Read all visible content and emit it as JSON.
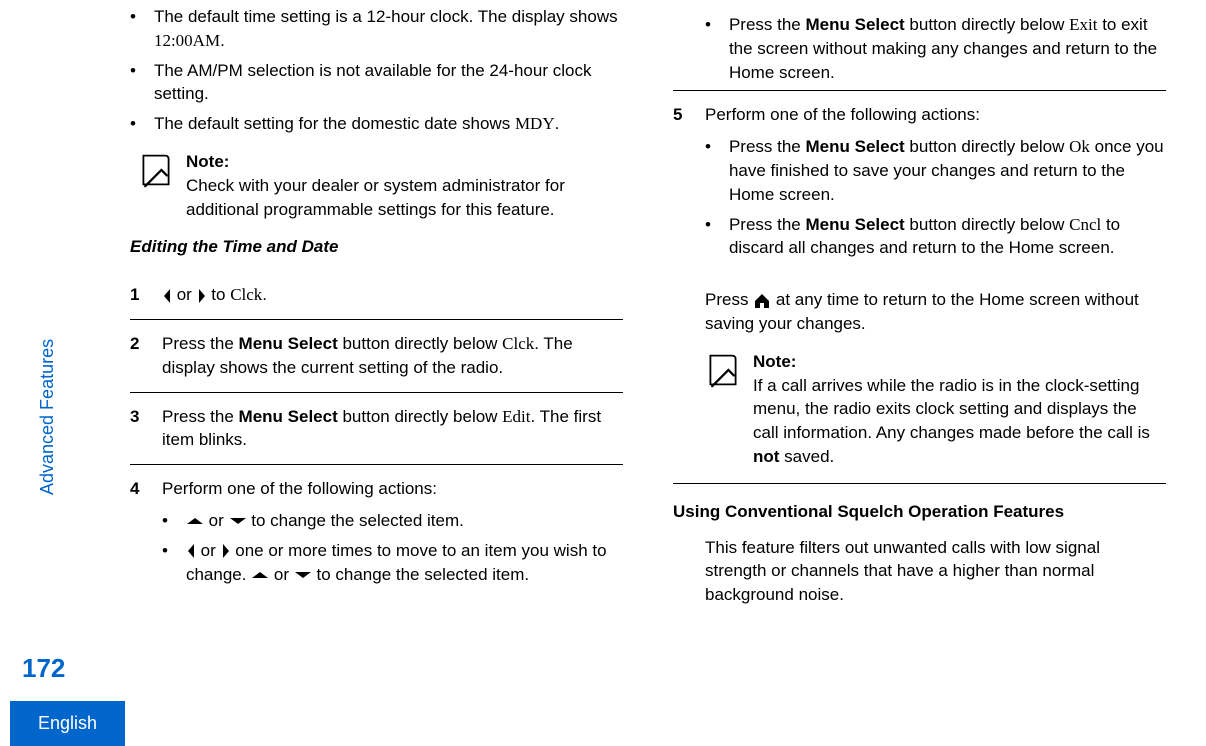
{
  "sideRail": {
    "sectionLabel": "Advanced Features",
    "pageNumber": "172",
    "language": "English"
  },
  "col1": {
    "bullets": {
      "b1a": "The default time setting is a 12-hour clock. The display shows ",
      "b1b": "12:00AM",
      "b1c": ".",
      "b2": "The AM/PM selection is not available for the 24-hour clock setting.",
      "b3a": "The default setting for the domestic date shows ",
      "b3b": "MDY",
      "b3c": "."
    },
    "note": {
      "title": "Note:",
      "body": "Check with your dealer or system administrator for additional programmable settings for this feature."
    },
    "heading": "Editing the Time and Date",
    "step1": {
      "num": "1",
      "or": " or ",
      "to": " to ",
      "target": "Clck",
      "dot": "."
    },
    "step2": {
      "num": "2",
      "a": "Press the ",
      "b": "Menu Select",
      "c": " button directly below ",
      "d": "Clck",
      "e": ". The display shows the current setting of the radio."
    },
    "step3": {
      "num": "3",
      "a": "Press the ",
      "b": "Menu Select",
      "c": " button directly below ",
      "d": "Edit",
      "e": ". The first item blinks."
    },
    "step4": {
      "num": "4",
      "lead": "Perform one of the following actions:",
      "sb1": {
        "or": " or ",
        "tail": " to change the selected item."
      },
      "sb2": {
        "or": " or ",
        "mid": " one or more times to move to an item you wish to change. ",
        "or2": " or ",
        "tail": " to change the selected item."
      }
    }
  },
  "col2": {
    "topBullet": {
      "a": "Press the ",
      "b": "Menu Select",
      "c": " button directly below ",
      "d": "Exit",
      "e": " to exit the screen without making any changes and return to the Home screen."
    },
    "step5": {
      "num": "5",
      "lead": "Perform one of the following actions:",
      "sb1": {
        "a": "Press the ",
        "b": "Menu Select",
        "c": " button directly below ",
        "d": "Ok",
        "e": " once you have finished to save your changes and return to the Home screen."
      },
      "sb2": {
        "a": "Press the ",
        "b": "Menu Select",
        "c": " button directly below ",
        "d": "Cncl",
        "e": " to discard all changes and return to the Home screen."
      }
    },
    "pressHome": {
      "a": "Press ",
      "b": " at any time to return to the Home screen without saving your changes."
    },
    "note": {
      "title": "Note:",
      "a": "If a call arrives while the radio is in the clock-setting menu, the radio exits clock setting and displays the call information. Any changes made before the call is ",
      "b": "not",
      "c": " saved."
    },
    "heading": "Using Conventional Squelch Operation Features",
    "para": "This feature filters out unwanted calls with low signal strength or channels that have a higher than normal background noise."
  }
}
